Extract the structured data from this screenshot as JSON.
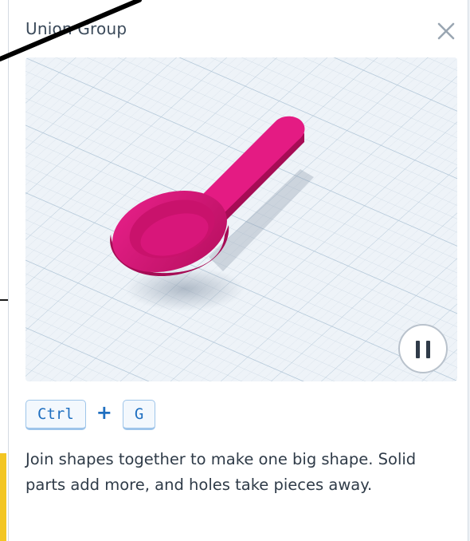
{
  "dialog": {
    "title": "Union Group",
    "close_icon": "close-icon",
    "description": "Join shapes together to make one big shape. Solid parts add more, and holes take pieces away."
  },
  "preview": {
    "pause_icon": "pause-icon",
    "shape_color": "#d0156f"
  },
  "shortcut": {
    "key1": "Ctrl",
    "plus": "+",
    "key2": "G"
  },
  "colors": {
    "accent": "#1f6fc0",
    "key_border": "#9ec5ea",
    "title_text": "#3b4a5a",
    "body_text": "#2f3b48"
  }
}
